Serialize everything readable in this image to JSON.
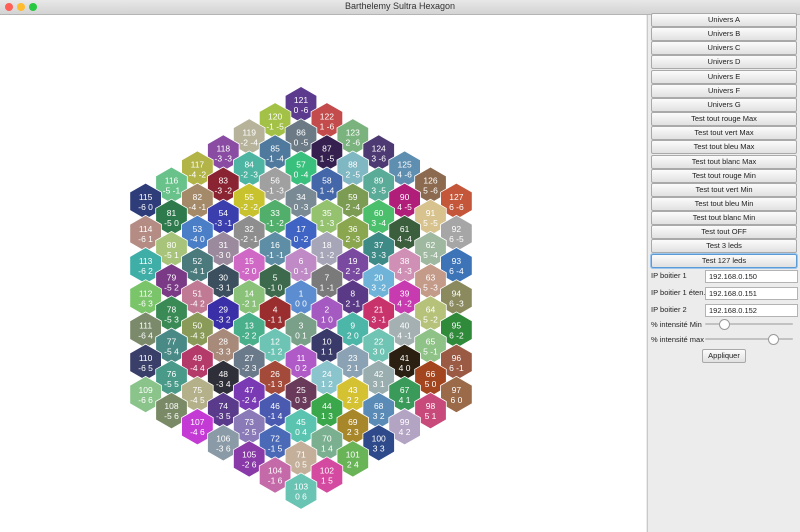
{
  "window": {
    "title": "Barthelemy Sultra Hexagon",
    "dots": [
      "#ff5f57",
      "#febc2e",
      "#28c840"
    ]
  },
  "hexagons": [
    {
      "n": "121",
      "c": "0 -6",
      "color": "#5c3a8e",
      "q": 0,
      "r": -6
    },
    {
      "n": "122",
      "c": "1 -6",
      "color": "#c34b4b",
      "q": 1,
      "r": -6
    },
    {
      "n": "123",
      "c": "2 -6",
      "color": "#7bb37f",
      "q": 2,
      "r": -6
    },
    {
      "n": "124",
      "c": "3 -6",
      "color": "#4e3a73",
      "q": 3,
      "r": -6
    },
    {
      "n": "125",
      "c": "4 -6",
      "color": "#5f8fb0",
      "q": 4,
      "r": -6
    },
    {
      "n": "126",
      "c": "5 -6",
      "color": "#8b6a4f",
      "q": 5,
      "r": -6
    },
    {
      "n": "127",
      "c": "6 -6",
      "color": "#c4573a",
      "q": 6,
      "r": -6
    },
    {
      "n": "120",
      "c": "-1 -5",
      "color": "#a3c146",
      "q": -1,
      "r": -5
    },
    {
      "n": "86",
      "c": "0 -5",
      "color": "#6c7a86",
      "q": 0,
      "r": -5
    },
    {
      "n": "87",
      "c": "1 -5",
      "color": "#35204f",
      "q": 1,
      "r": -5
    },
    {
      "n": "88",
      "c": "2 -5",
      "color": "#7fb7c2",
      "q": 2,
      "r": -5
    },
    {
      "n": "89",
      "c": "3 -5",
      "color": "#5aab98",
      "q": 3,
      "r": -5
    },
    {
      "n": "90",
      "c": "4 -5",
      "color": "#b01e7a",
      "q": 4,
      "r": -5
    },
    {
      "n": "91",
      "c": "5 -5",
      "color": "#d8c38e",
      "q": 5,
      "r": -5
    },
    {
      "n": "92",
      "c": "6 -5",
      "color": "#a6a6a6",
      "q": 6,
      "r": -5
    },
    {
      "n": "119",
      "c": "-2 -4",
      "color": "#b7b39a",
      "q": -2,
      "r": -4
    },
    {
      "n": "85",
      "c": "-1 -4",
      "color": "#4f7a9e",
      "q": -1,
      "r": -4
    },
    {
      "n": "57",
      "c": "0 -4",
      "color": "#39c07c",
      "q": 0,
      "r": -4
    },
    {
      "n": "58",
      "c": "1 -4",
      "color": "#4467a9",
      "q": 1,
      "r": -4
    },
    {
      "n": "59",
      "c": "2 -4",
      "color": "#7d9c53",
      "q": 2,
      "r": -4
    },
    {
      "n": "60",
      "c": "3 -4",
      "color": "#4cbf6c",
      "q": 3,
      "r": -4
    },
    {
      "n": "61",
      "c": "4 -4",
      "color": "#3b5e3d",
      "q": 4,
      "r": -4
    },
    {
      "n": "62",
      "c": "5 -4",
      "color": "#9fb8a0",
      "q": 5,
      "r": -4
    },
    {
      "n": "93",
      "c": "6 -4",
      "color": "#3d74b8",
      "q": 6,
      "r": -4
    },
    {
      "n": "118",
      "c": "-3 -3",
      "color": "#8a4ca3",
      "q": -3,
      "r": -3
    },
    {
      "n": "84",
      "c": "-2 -3",
      "color": "#4db5a1",
      "q": -2,
      "r": -3
    },
    {
      "n": "56",
      "c": "-1 -3",
      "color": "#a0a0a0",
      "q": -1,
      "r": -3
    },
    {
      "n": "34",
      "c": "0 -3",
      "color": "#7a8a94",
      "q": 0,
      "r": -3
    },
    {
      "n": "35",
      "c": "1 -3",
      "color": "#95c26e",
      "q": 1,
      "r": -3
    },
    {
      "n": "36",
      "c": "2 -3",
      "color": "#8aa64e",
      "q": 2,
      "r": -3
    },
    {
      "n": "37",
      "c": "3 -3",
      "color": "#3e8a86",
      "q": 3,
      "r": -3
    },
    {
      "n": "38",
      "c": "4 -3",
      "color": "#d08fb4",
      "q": 4,
      "r": -3
    },
    {
      "n": "63",
      "c": "5 -3",
      "color": "#c49a88",
      "q": 5,
      "r": -3
    },
    {
      "n": "94",
      "c": "6 -3",
      "color": "#8a8a5e",
      "q": 6,
      "r": -3
    },
    {
      "n": "117",
      "c": "-4 -2",
      "color": "#b2b447",
      "q": -4,
      "r": -2
    },
    {
      "n": "83",
      "c": "-3 -2",
      "color": "#8b2432",
      "q": -3,
      "r": -2
    },
    {
      "n": "55",
      "c": "-2 -2",
      "color": "#c8c22f",
      "q": -2,
      "r": -2
    },
    {
      "n": "33",
      "c": "-1 -2",
      "color": "#52ae6b",
      "q": -1,
      "r": -2
    },
    {
      "n": "17",
      "c": "0 -2",
      "color": "#3f64c4",
      "q": 0,
      "r": -2
    },
    {
      "n": "18",
      "c": "1 -2",
      "color": "#a6a6b8",
      "q": 1,
      "r": -2
    },
    {
      "n": "19",
      "c": "2 -2",
      "color": "#7a4aa0",
      "q": 2,
      "r": -2
    },
    {
      "n": "20",
      "c": "3 -2",
      "color": "#6fb3d8",
      "q": 3,
      "r": -2
    },
    {
      "n": "39",
      "c": "4 -2",
      "color": "#c83ab0",
      "q": 4,
      "r": -2
    },
    {
      "n": "64",
      "c": "5 -2",
      "color": "#b6c27a",
      "q": 5,
      "r": -2
    },
    {
      "n": "95",
      "c": "6 -2",
      "color": "#2f8a3a",
      "q": 6,
      "r": -2
    },
    {
      "n": "116",
      "c": "-5 -1",
      "color": "#68c28a",
      "q": -5,
      "r": -1
    },
    {
      "n": "82",
      "c": "-4 -1",
      "color": "#a58a6a",
      "q": -4,
      "r": -1
    },
    {
      "n": "54",
      "c": "-3 -1",
      "color": "#3b3fae",
      "q": -3,
      "r": -1
    },
    {
      "n": "32",
      "c": "-2 -1",
      "color": "#8e8e8e",
      "q": -2,
      "r": -1
    },
    {
      "n": "16",
      "c": "-1 -1",
      "color": "#5e8ea6",
      "q": -1,
      "r": -1
    },
    {
      "n": "6",
      "c": "0 -1",
      "color": "#c08ac6",
      "q": 0,
      "r": -1
    },
    {
      "n": "7",
      "c": "1 -1",
      "color": "#7a7a7a",
      "q": 1,
      "r": -1
    },
    {
      "n": "8",
      "c": "2 -1",
      "color": "#5a3a86",
      "q": 2,
      "r": -1
    },
    {
      "n": "21",
      "c": "3 -1",
      "color": "#c8336c",
      "q": 3,
      "r": -1
    },
    {
      "n": "40",
      "c": "4 -1",
      "color": "#a4b0b2",
      "q": 4,
      "r": -1
    },
    {
      "n": "65",
      "c": "5 -1",
      "color": "#8ec286",
      "q": 5,
      "r": -1
    },
    {
      "n": "96",
      "c": "6 -1",
      "color": "#9a5a44",
      "q": 6,
      "r": -1
    },
    {
      "n": "115",
      "c": "-6 0",
      "color": "#2e3c7a",
      "q": -6,
      "r": 0
    },
    {
      "n": "81",
      "c": "-5 0",
      "color": "#2f7a4c",
      "q": -5,
      "r": 0
    },
    {
      "n": "53",
      "c": "-4 0",
      "color": "#4a7ec6",
      "q": -4,
      "r": 0
    },
    {
      "n": "31",
      "c": "-3 0",
      "color": "#9b8a9e",
      "q": -3,
      "r": 0
    },
    {
      "n": "15",
      "c": "-2 0",
      "color": "#d069c6",
      "q": -2,
      "r": 0
    },
    {
      "n": "5",
      "c": "-1 0",
      "color": "#3d6a4c",
      "q": -1,
      "r": 0
    },
    {
      "n": "1",
      "c": "0 0",
      "color": "#5b8dd0",
      "q": 0,
      "r": 0
    },
    {
      "n": "2",
      "c": "1 0",
      "color": "#a55ac2",
      "q": 1,
      "r": 0
    },
    {
      "n": "9",
      "c": "2 0",
      "color": "#4cb6a9",
      "q": 2,
      "r": 0
    },
    {
      "n": "22",
      "c": "3 0",
      "color": "#6fc4b4",
      "q": 3,
      "r": 0
    },
    {
      "n": "41",
      "c": "4 0",
      "color": "#2a1f10",
      "q": 4,
      "r": 0
    },
    {
      "n": "66",
      "c": "5 0",
      "color": "#a3461f",
      "q": 5,
      "r": 0
    },
    {
      "n": "97",
      "c": "6 0",
      "color": "#9b6a48",
      "q": 6,
      "r": 0
    },
    {
      "n": "114",
      "c": "-6 1",
      "color": "#b48c84",
      "q": -6,
      "r": 1
    },
    {
      "n": "80",
      "c": "-5 1",
      "color": "#a8c47a",
      "q": -5,
      "r": 1
    },
    {
      "n": "52",
      "c": "-4 1",
      "color": "#4a7a7c",
      "q": -4,
      "r": 1
    },
    {
      "n": "30",
      "c": "-3 1",
      "color": "#3b4f5e",
      "q": -3,
      "r": 1
    },
    {
      "n": "14",
      "c": "-2 1",
      "color": "#8ac27a",
      "q": -2,
      "r": 1
    },
    {
      "n": "4",
      "c": "-1 1",
      "color": "#9a2d2d",
      "q": -1,
      "r": 1
    },
    {
      "n": "3",
      "c": "0 1",
      "color": "#7aa08a",
      "q": 0,
      "r": 1
    },
    {
      "n": "10",
      "c": "1 1",
      "color": "#3a3a6a",
      "q": 1,
      "r": 1
    },
    {
      "n": "23",
      "c": "2 1",
      "color": "#8aa2b4",
      "q": 2,
      "r": 1
    },
    {
      "n": "42",
      "c": "3 1",
      "color": "#9aaeb0",
      "q": 3,
      "r": 1
    },
    {
      "n": "67",
      "c": "4 1",
      "color": "#3a9a5a",
      "q": 4,
      "r": 1
    },
    {
      "n": "98",
      "c": "5 1",
      "color": "#c84a7a",
      "q": 5,
      "r": 1
    },
    {
      "n": "113",
      "c": "-6 2",
      "color": "#3eaea6",
      "q": -6,
      "r": 2
    },
    {
      "n": "79",
      "c": "-5 2",
      "color": "#7a3a86",
      "q": -5,
      "r": 2
    },
    {
      "n": "51",
      "c": "-4 2",
      "color": "#c07a94",
      "q": -4,
      "r": 2
    },
    {
      "n": "29",
      "c": "-3 2",
      "color": "#3a2fa6",
      "q": -3,
      "r": 2
    },
    {
      "n": "13",
      "c": "-2 2",
      "color": "#4ab08c",
      "q": -2,
      "r": 2
    },
    {
      "n": "12",
      "c": "-1 2",
      "color": "#6ec4b4",
      "q": -1,
      "r": 2
    },
    {
      "n": "11",
      "c": "0 2",
      "color": "#b05ac8",
      "q": 0,
      "r": 2
    },
    {
      "n": "24",
      "c": "1 2",
      "color": "#8ac4cc",
      "q": 1,
      "r": 2
    },
    {
      "n": "43",
      "c": "2 2",
      "color": "#d4c233",
      "q": 2,
      "r": 2
    },
    {
      "n": "68",
      "c": "3 2",
      "color": "#5a8ab6",
      "q": 3,
      "r": 2
    },
    {
      "n": "99",
      "c": "4 2",
      "color": "#b4a4c4",
      "q": 4,
      "r": 2
    },
    {
      "n": "112",
      "c": "-6 3",
      "color": "#7ac46a",
      "q": -6,
      "r": 3
    },
    {
      "n": "78",
      "c": "-5 3",
      "color": "#3a8a56",
      "q": -5,
      "r": 3
    },
    {
      "n": "50",
      "c": "-4 3",
      "color": "#8a9a58",
      "q": -4,
      "r": 3
    },
    {
      "n": "28",
      "c": "-3 3",
      "color": "#a88a7a",
      "q": -3,
      "r": 3
    },
    {
      "n": "27",
      "c": "-2 3",
      "color": "#6a7a8a",
      "q": -2,
      "r": 3
    },
    {
      "n": "26",
      "c": "-1 3",
      "color": "#a44a3a",
      "q": -1,
      "r": 3
    },
    {
      "n": "25",
      "c": "0 3",
      "color": "#6a3a5a",
      "q": 0,
      "r": 3
    },
    {
      "n": "44",
      "c": "1 3",
      "color": "#3aa84a",
      "q": 1,
      "r": 3
    },
    {
      "n": "69",
      "c": "2 3",
      "color": "#a8862a",
      "q": 2,
      "r": 3
    },
    {
      "n": "100",
      "c": "3 3",
      "color": "#2f4a8a",
      "q": 3,
      "r": 3
    },
    {
      "n": "111",
      "c": "-6 4",
      "color": "#7a8a6a",
      "q": -6,
      "r": 4
    },
    {
      "n": "77",
      "c": "-5 4",
      "color": "#4a8a86",
      "q": -5,
      "r": 4
    },
    {
      "n": "49",
      "c": "-4 4",
      "color": "#b43a6a",
      "q": -4,
      "r": 4
    },
    {
      "n": "48",
      "c": "-3 4",
      "color": "#2f2f3a",
      "q": -3,
      "r": 4
    },
    {
      "n": "47",
      "c": "-2 4",
      "color": "#7a3ab4",
      "q": -2,
      "r": 4
    },
    {
      "n": "46",
      "c": "-1 4",
      "color": "#4a5ab0",
      "q": -1,
      "r": 4
    },
    {
      "n": "45",
      "c": "0 4",
      "color": "#5ac4b0",
      "q": 0,
      "r": 4
    },
    {
      "n": "70",
      "c": "1 4",
      "color": "#7ab090",
      "q": 1,
      "r": 4
    },
    {
      "n": "101",
      "c": "2 4",
      "color": "#6ab458",
      "q": 2,
      "r": 4
    },
    {
      "n": "110",
      "c": "-6 5",
      "color": "#3a3f6a",
      "q": -6,
      "r": 5
    },
    {
      "n": "76",
      "c": "-5 5",
      "color": "#4a9a8a",
      "q": -5,
      "r": 5
    },
    {
      "n": "75",
      "c": "-4 5",
      "color": "#b4b08a",
      "q": -4,
      "r": 5
    },
    {
      "n": "74",
      "c": "-3 5",
      "color": "#5a3a8a",
      "q": -3,
      "r": 5
    },
    {
      "n": "73",
      "c": "-2 5",
      "color": "#8a7ab8",
      "q": -2,
      "r": 5
    },
    {
      "n": "72",
      "c": "-1 5",
      "color": "#4a6ab8",
      "q": -1,
      "r": 5
    },
    {
      "n": "71",
      "c": "0 5",
      "color": "#c4b09a",
      "q": 0,
      "r": 5
    },
    {
      "n": "102",
      "c": "1 5",
      "color": "#d44aa0",
      "q": 1,
      "r": 5
    },
    {
      "n": "109",
      "c": "-6 6",
      "color": "#8ac48a",
      "q": -6,
      "r": 6
    },
    {
      "n": "108",
      "c": "-5 6",
      "color": "#7a8a66",
      "q": -5,
      "r": 6
    },
    {
      "n": "107",
      "c": "-4 6",
      "color": "#c43ad4",
      "q": -4,
      "r": 6
    },
    {
      "n": "106",
      "c": "-3 6",
      "color": "#8a9aa6",
      "q": -3,
      "r": 6
    },
    {
      "n": "105",
      "c": "-2 6",
      "color": "#8a3aa8",
      "q": -2,
      "r": 6
    },
    {
      "n": "104",
      "c": "-1 6",
      "color": "#c46aa8",
      "q": -1,
      "r": 6
    },
    {
      "n": "103",
      "c": "0 6",
      "color": "#6ac4b4",
      "q": 0,
      "r": 6
    }
  ],
  "panel": {
    "buttons": [
      {
        "id": "univers-a",
        "label": "Univers A"
      },
      {
        "id": "univers-b",
        "label": "Univers B"
      },
      {
        "id": "univers-c",
        "label": "Univers C"
      },
      {
        "id": "univers-d",
        "label": "Univers D"
      },
      {
        "id": "univers-e",
        "label": "Univers E"
      },
      {
        "id": "univers-f",
        "label": "Univers F"
      },
      {
        "id": "univers-g",
        "label": "Univers G"
      },
      {
        "id": "test-rouge-max",
        "label": "Test tout rouge Max"
      },
      {
        "id": "test-vert-max",
        "label": "Test tout vert Max"
      },
      {
        "id": "test-bleu-max",
        "label": "Test tout bleu Max"
      },
      {
        "id": "test-blanc-max",
        "label": "Test tout blanc Max"
      },
      {
        "id": "test-rouge-min",
        "label": "Test tout rouge Min"
      },
      {
        "id": "test-vert-min",
        "label": "Test tout vert Min"
      },
      {
        "id": "test-bleu-min",
        "label": "Test tout bleu Min"
      },
      {
        "id": "test-blanc-min",
        "label": "Test tout blanc Min"
      },
      {
        "id": "test-off",
        "label": "Test tout OFF"
      },
      {
        "id": "test-3-leds",
        "label": "Test 3 leds"
      },
      {
        "id": "test-127-leds",
        "label": "Test 127 leds"
      }
    ],
    "ip1": {
      "label": "IP boitier 1",
      "value": "192.168.0.150"
    },
    "ip_ext": {
      "label": "IP boitier 1 éten...",
      "value": "192.168.0.151"
    },
    "ip2": {
      "label": "IP boitier 2",
      "value": "192.168.0.152"
    },
    "intensity_min": {
      "label": "% intensité Min",
      "value": 0.18
    },
    "intensity_max": {
      "label": "% intensité max",
      "value": 0.8
    },
    "apply_label": "Appliquer"
  }
}
